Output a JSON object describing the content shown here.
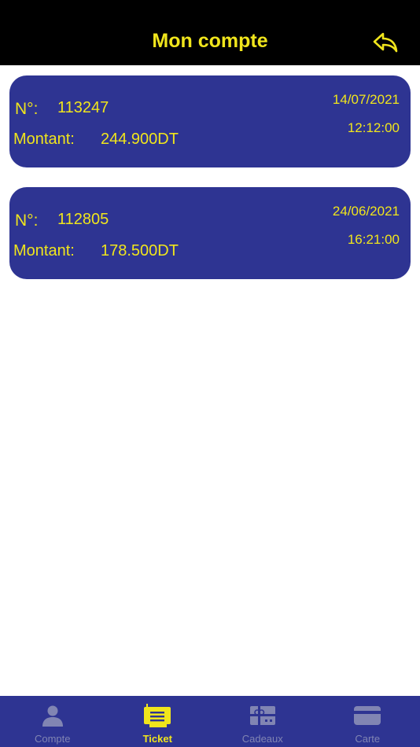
{
  "header": {
    "title": "Mon compte",
    "back_icon": "reply-arrow-icon"
  },
  "tickets": [
    {
      "number_label": "N°:",
      "number": "113247",
      "amount_label": "Montant:",
      "amount": "244.900DT",
      "date": "14/07/2021",
      "time": "12:12:00"
    },
    {
      "number_label": "N°:",
      "number": "112805",
      "amount_label": "Montant:",
      "amount": "178.500DT",
      "date": "24/06/2021",
      "time": "16:21:00"
    }
  ],
  "tabbar": {
    "active": "Ticket",
    "tabs": [
      {
        "label": "Compte",
        "icon": "person-icon"
      },
      {
        "label": "Ticket",
        "icon": "ticket-icon"
      },
      {
        "label": "Cadeaux",
        "icon": "gift-card-icon"
      },
      {
        "label": "Carte",
        "icon": "credit-card-icon"
      }
    ]
  },
  "colors": {
    "accent": "#f0e51c",
    "primary": "#2e3492",
    "header_bg": "#000000",
    "inactive_tab": "#8185b3"
  }
}
